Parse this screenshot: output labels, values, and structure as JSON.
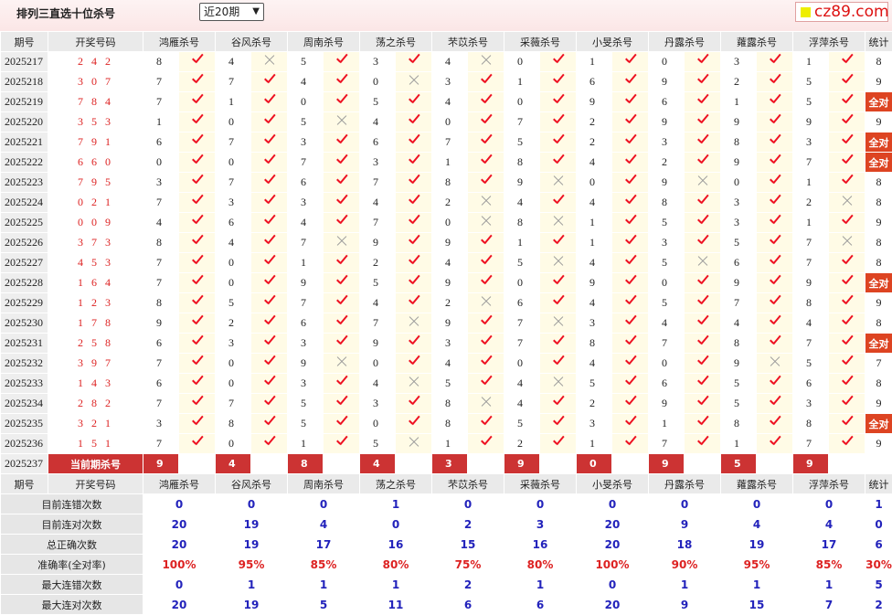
{
  "header": {
    "title": "排列三直选十位杀号",
    "period_select": "近20期",
    "logo": "cz89.com"
  },
  "columns": {
    "period": "期号",
    "draw": "开奖号码",
    "status": "统计",
    "experts": [
      "鸿雁杀号",
      "谷风杀号",
      "周南杀号",
      "荡之杀号",
      "芣苡杀号",
      "采薇杀号",
      "小旻杀号",
      "丹露杀号",
      "蕹露杀号",
      "浮萍杀号"
    ]
  },
  "rows": [
    {
      "p": "2025217",
      "d": "2 4 2",
      "k": [
        "8",
        "4",
        "5",
        "3",
        "4",
        "0",
        "1",
        "0",
        "3",
        "1"
      ],
      "r": [
        1,
        0,
        1,
        1,
        0,
        1,
        1,
        1,
        1,
        1
      ],
      "s": "8"
    },
    {
      "p": "2025218",
      "d": "3 0 7",
      "k": [
        "7",
        "7",
        "4",
        "0",
        "3",
        "1",
        "6",
        "9",
        "2",
        "5"
      ],
      "r": [
        1,
        1,
        1,
        0,
        1,
        1,
        1,
        1,
        1,
        1
      ],
      "s": "9"
    },
    {
      "p": "2025219",
      "d": "7 8 4",
      "k": [
        "7",
        "1",
        "0",
        "5",
        "4",
        "0",
        "9",
        "6",
        "1",
        "5"
      ],
      "r": [
        1,
        1,
        1,
        1,
        1,
        1,
        1,
        1,
        1,
        1
      ],
      "s": "全对"
    },
    {
      "p": "2025220",
      "d": "3 5 3",
      "k": [
        "1",
        "0",
        "5",
        "4",
        "0",
        "7",
        "2",
        "9",
        "9",
        "9"
      ],
      "r": [
        1,
        1,
        0,
        1,
        1,
        1,
        1,
        1,
        1,
        1
      ],
      "s": "9"
    },
    {
      "p": "2025221",
      "d": "7 9 1",
      "k": [
        "6",
        "7",
        "3",
        "6",
        "7",
        "5",
        "2",
        "3",
        "8",
        "3"
      ],
      "r": [
        1,
        1,
        1,
        1,
        1,
        1,
        1,
        1,
        1,
        1
      ],
      "s": "全对"
    },
    {
      "p": "2025222",
      "d": "6 6 0",
      "k": [
        "0",
        "0",
        "7",
        "3",
        "1",
        "8",
        "4",
        "2",
        "9",
        "7"
      ],
      "r": [
        1,
        1,
        1,
        1,
        1,
        1,
        1,
        1,
        1,
        1
      ],
      "s": "全对"
    },
    {
      "p": "2025223",
      "d": "7 9 5",
      "k": [
        "3",
        "7",
        "6",
        "7",
        "8",
        "9",
        "0",
        "9",
        "0",
        "1"
      ],
      "r": [
        1,
        1,
        1,
        1,
        1,
        0,
        1,
        0,
        1,
        1
      ],
      "s": "8"
    },
    {
      "p": "2025224",
      "d": "0 2 1",
      "k": [
        "7",
        "3",
        "3",
        "4",
        "2",
        "4",
        "4",
        "8",
        "3",
        "2"
      ],
      "r": [
        1,
        1,
        1,
        1,
        0,
        1,
        1,
        1,
        1,
        0
      ],
      "s": "8"
    },
    {
      "p": "2025225",
      "d": "0 0 9",
      "k": [
        "4",
        "6",
        "4",
        "7",
        "0",
        "8",
        "1",
        "5",
        "3",
        "1"
      ],
      "r": [
        1,
        1,
        1,
        1,
        0,
        0,
        1,
        1,
        1,
        1
      ],
      "s": "9"
    },
    {
      "p": "2025226",
      "d": "3 7 3",
      "k": [
        "8",
        "4",
        "7",
        "9",
        "9",
        "1",
        "1",
        "3",
        "5",
        "7"
      ],
      "r": [
        1,
        1,
        0,
        1,
        1,
        1,
        1,
        1,
        1,
        0
      ],
      "s": "8"
    },
    {
      "p": "2025227",
      "d": "4 5 3",
      "k": [
        "7",
        "0",
        "1",
        "2",
        "4",
        "5",
        "4",
        "5",
        "6",
        "7"
      ],
      "r": [
        1,
        1,
        1,
        1,
        1,
        0,
        1,
        0,
        1,
        1
      ],
      "s": "8"
    },
    {
      "p": "2025228",
      "d": "1 6 4",
      "k": [
        "7",
        "0",
        "9",
        "5",
        "9",
        "0",
        "9",
        "0",
        "9",
        "9"
      ],
      "r": [
        1,
        1,
        1,
        1,
        1,
        1,
        1,
        1,
        1,
        1
      ],
      "s": "全对"
    },
    {
      "p": "2025229",
      "d": "1 2 3",
      "k": [
        "8",
        "5",
        "7",
        "4",
        "2",
        "6",
        "4",
        "5",
        "7",
        "8"
      ],
      "r": [
        1,
        1,
        1,
        1,
        0,
        1,
        1,
        1,
        1,
        1
      ],
      "s": "9"
    },
    {
      "p": "2025230",
      "d": "1 7 8",
      "k": [
        "9",
        "2",
        "6",
        "7",
        "9",
        "7",
        "3",
        "4",
        "4",
        "4"
      ],
      "r": [
        1,
        1,
        1,
        0,
        1,
        0,
        1,
        1,
        1,
        1
      ],
      "s": "8"
    },
    {
      "p": "2025231",
      "d": "2 5 8",
      "k": [
        "6",
        "3",
        "3",
        "9",
        "3",
        "7",
        "8",
        "7",
        "8",
        "7"
      ],
      "r": [
        1,
        1,
        1,
        1,
        1,
        1,
        1,
        1,
        1,
        1
      ],
      "s": "全对"
    },
    {
      "p": "2025232",
      "d": "3 9 7",
      "k": [
        "7",
        "0",
        "9",
        "0",
        "4",
        "0",
        "4",
        "0",
        "9",
        "5"
      ],
      "r": [
        1,
        1,
        0,
        1,
        1,
        1,
        1,
        1,
        0,
        1
      ],
      "s": "7"
    },
    {
      "p": "2025233",
      "d": "1 4 3",
      "k": [
        "6",
        "0",
        "3",
        "4",
        "5",
        "4",
        "5",
        "6",
        "5",
        "6"
      ],
      "r": [
        1,
        1,
        1,
        0,
        1,
        0,
        1,
        1,
        1,
        1
      ],
      "s": "8"
    },
    {
      "p": "2025234",
      "d": "2 8 2",
      "k": [
        "7",
        "7",
        "5",
        "3",
        "8",
        "4",
        "2",
        "9",
        "5",
        "3"
      ],
      "r": [
        1,
        1,
        1,
        1,
        0,
        1,
        1,
        1,
        1,
        1
      ],
      "s": "9"
    },
    {
      "p": "2025235",
      "d": "3 2 1",
      "k": [
        "3",
        "8",
        "5",
        "0",
        "8",
        "5",
        "3",
        "1",
        "8",
        "8"
      ],
      "r": [
        1,
        1,
        1,
        1,
        1,
        1,
        1,
        1,
        1,
        1
      ],
      "s": "全对"
    },
    {
      "p": "2025236",
      "d": "1 5 1",
      "k": [
        "7",
        "0",
        "1",
        "5",
        "1",
        "2",
        "1",
        "7",
        "1",
        "7"
      ],
      "r": [
        1,
        1,
        1,
        0,
        1,
        1,
        1,
        1,
        1,
        1
      ],
      "s": "9"
    }
  ],
  "current": {
    "p": "2025237",
    "label": "当前期杀号",
    "k": [
      "9",
      "4",
      "8",
      "4",
      "3",
      "9",
      "0",
      "9",
      "5",
      "9"
    ]
  },
  "summary": [
    {
      "label": "目前连错次数",
      "v": [
        "0",
        "0",
        "0",
        "1",
        "0",
        "0",
        "0",
        "0",
        "0",
        "0"
      ],
      "s": "1",
      "acc": false
    },
    {
      "label": "目前连对次数",
      "v": [
        "20",
        "19",
        "4",
        "0",
        "2",
        "3",
        "20",
        "9",
        "4",
        "4"
      ],
      "s": "0",
      "acc": false
    },
    {
      "label": "总正确次数",
      "v": [
        "20",
        "19",
        "17",
        "16",
        "15",
        "16",
        "20",
        "18",
        "19",
        "17"
      ],
      "s": "6",
      "acc": false
    },
    {
      "label": "准确率(全对率)",
      "v": [
        "100%",
        "95%",
        "85%",
        "80%",
        "75%",
        "80%",
        "100%",
        "90%",
        "95%",
        "85%"
      ],
      "s": "30%",
      "acc": true
    },
    {
      "label": "最大连错次数",
      "v": [
        "0",
        "1",
        "1",
        "1",
        "2",
        "1",
        "0",
        "1",
        "1",
        "1"
      ],
      "s": "5",
      "acc": false
    },
    {
      "label": "最大连对次数",
      "v": [
        "20",
        "19",
        "5",
        "11",
        "6",
        "6",
        "20",
        "9",
        "15",
        "7"
      ],
      "s": "2",
      "acc": false
    }
  ]
}
